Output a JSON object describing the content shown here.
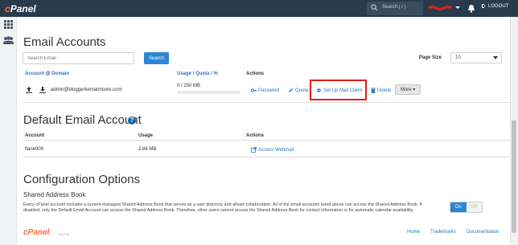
{
  "topbar": {
    "logo_c": "c",
    "logo_rest": "Panel",
    "search_placeholder": "Search ( / )",
    "logout_label": "LOGOUT"
  },
  "email_accounts": {
    "title": "Email Accounts",
    "search_placeholder": "Search Email",
    "search_button": "Search",
    "page_size_label": "Page Size",
    "page_size_value": "10",
    "columns": {
      "account": "Account",
      "at": "@",
      "domain": "Domain",
      "usage": "Usage / Quota / %",
      "actions": "Actions"
    },
    "rows": [
      {
        "account": "admin@bloggerkemarinsore.com",
        "usage": "0 / 250 MB",
        "usage_fraction": 0,
        "actions": {
          "password": "Password",
          "quota": "Quota",
          "setup": "Set Up Mail Client",
          "delete": "Delete",
          "more": "More"
        }
      }
    ]
  },
  "default_account": {
    "title": "Default Email Account",
    "columns": {
      "account": "Account",
      "usage": "Usage",
      "actions": "Actions"
    },
    "row": {
      "account": "flane909",
      "usage": "2.86 MB",
      "action": "Access Webmail"
    }
  },
  "configuration": {
    "title": "Configuration Options",
    "shared_title": "Shared Address Book",
    "shared_desc": "Every cPanel account includes a system-managed Shared Address Book that serves as a user directory and allows collaboration. All of the email accounts listed above can access the Shared Address Book. If disabled, only the Default Email Account can access the Shared Address Book. Therefore, other users cannot access the Shared Address Book for contact information or for automatic calendar availability.",
    "toggle_on": "On",
    "toggle_off": "Off"
  },
  "footer": {
    "logo": "cPanel",
    "version": "94.0.10",
    "links": [
      "Home",
      "Trademarks",
      "Documentation"
    ]
  },
  "colors": {
    "topbar": "#293a4a",
    "brand": "#ff6c2c",
    "accent": "#2b87d4",
    "highlight": "#e41b1b"
  }
}
